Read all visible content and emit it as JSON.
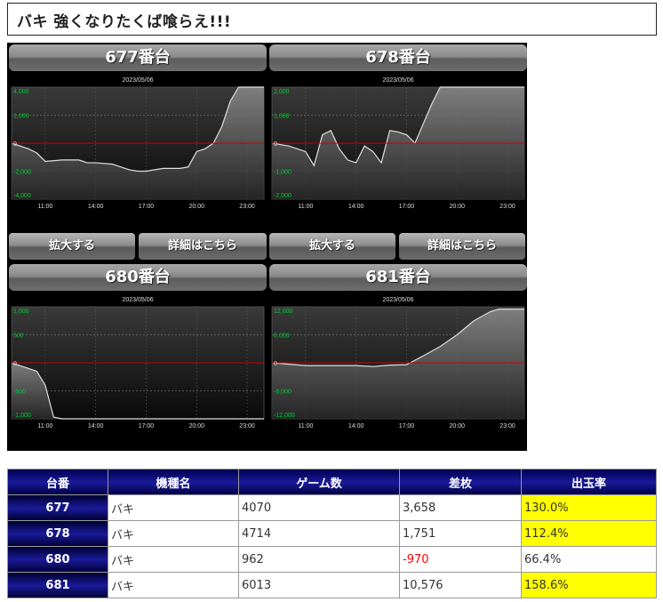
{
  "page_title": "バキ 強くなりたくば喰らえ!!!",
  "buttons": {
    "zoom": "拡大する",
    "detail": "詳細はこちら"
  },
  "colors": {
    "zero_line": "#cc0000",
    "y_label": "#00cc33",
    "area_fill": "#6a6a6a",
    "highlight": "#ffff00",
    "negative": "#ff0000"
  },
  "chart_data": [
    {
      "type": "area",
      "title": "677番台",
      "date": "2023/05/06",
      "y_ticks": [
        "4,000",
        "2,000",
        "0",
        "-2,000",
        "-4,000"
      ],
      "ylim": [
        -4000,
        4000
      ],
      "x_ticks": [
        "11:00",
        "14:00",
        "17:00",
        "20:00",
        "23:00"
      ],
      "x": [
        "09:00",
        "10:00",
        "10:30",
        "11:00",
        "12:00",
        "13:00",
        "13:30",
        "14:00",
        "15:00",
        "16:00",
        "16:30",
        "17:00",
        "18:00",
        "19:00",
        "19:30",
        "20:00",
        "20:30",
        "21:00",
        "21:30",
        "22:00",
        "22:30",
        "23:00",
        "24:00"
      ],
      "values": [
        0,
        -400,
        -700,
        -1300,
        -1200,
        -1200,
        -1400,
        -1400,
        -1500,
        -1900,
        -2000,
        -2000,
        -1800,
        -1800,
        -1700,
        -600,
        -400,
        0,
        1200,
        3000,
        4000,
        4000,
        4000
      ]
    },
    {
      "type": "area",
      "title": "678番台",
      "date": "2023/05/06",
      "y_ticks": [
        "2,000",
        "1,000",
        "0",
        "-1,000",
        "-2,000"
      ],
      "ylim": [
        -2000,
        2000
      ],
      "x_ticks": [
        "11:00",
        "14:00",
        "17:00",
        "20:00",
        "23:00"
      ],
      "x": [
        "09:00",
        "10:00",
        "11:00",
        "11:30",
        "12:00",
        "12:30",
        "13:00",
        "13:30",
        "14:00",
        "14:30",
        "15:00",
        "15:30",
        "16:00",
        "16:30",
        "17:00",
        "17:30",
        "18:00",
        "18:30",
        "19:00",
        "24:00"
      ],
      "values": [
        0,
        -100,
        -300,
        -800,
        300,
        450,
        -200,
        -600,
        -700,
        -100,
        -300,
        -700,
        450,
        400,
        300,
        0,
        700,
        1400,
        2000,
        2000
      ]
    },
    {
      "type": "area",
      "title": "680番台",
      "date": "2023/05/06",
      "y_ticks": [
        "1,000",
        "500",
        "0",
        "-500",
        "-1,000"
      ],
      "ylim": [
        -1000,
        1000
      ],
      "x_ticks": [
        "11:00",
        "14:00",
        "17:00",
        "20:00",
        "23:00"
      ],
      "x": [
        "09:00",
        "10:00",
        "10:30",
        "11:00",
        "11:30",
        "12:00",
        "24:00"
      ],
      "values": [
        0,
        -100,
        -150,
        -400,
        -970,
        -1000,
        -1000
      ]
    },
    {
      "type": "area",
      "title": "681番台",
      "date": "2023/05/06",
      "y_ticks": [
        "12,000",
        "6,000",
        "0",
        "-6,000",
        "-12,000"
      ],
      "ylim": [
        -12000,
        12000
      ],
      "x_ticks": [
        "11:00",
        "14:00",
        "17:00",
        "20:00",
        "23:00"
      ],
      "x": [
        "09:00",
        "11:00",
        "14:00",
        "15:00",
        "16:00",
        "17:00",
        "18:00",
        "19:00",
        "20:00",
        "21:00",
        "22:00",
        "22:30",
        "24:00"
      ],
      "values": [
        0,
        -600,
        -600,
        -800,
        -500,
        -400,
        1500,
        3500,
        6000,
        9000,
        11000,
        11500,
        11500
      ]
    }
  ],
  "table": {
    "headers": [
      "台番",
      "機種名",
      "ゲーム数",
      "差枚",
      "出玉率"
    ],
    "rows": [
      {
        "num": "677",
        "name": "バキ",
        "games": "4070",
        "diff": "3,658",
        "rate": "130.0%"
      },
      {
        "num": "678",
        "name": "バキ",
        "games": "4714",
        "diff": "1,751",
        "rate": "112.4%"
      },
      {
        "num": "680",
        "name": "バキ",
        "games": "962",
        "diff": "-970",
        "rate": "66.4%"
      },
      {
        "num": "681",
        "name": "バキ",
        "games": "6013",
        "diff": "10,576",
        "rate": "158.6%"
      }
    ]
  }
}
